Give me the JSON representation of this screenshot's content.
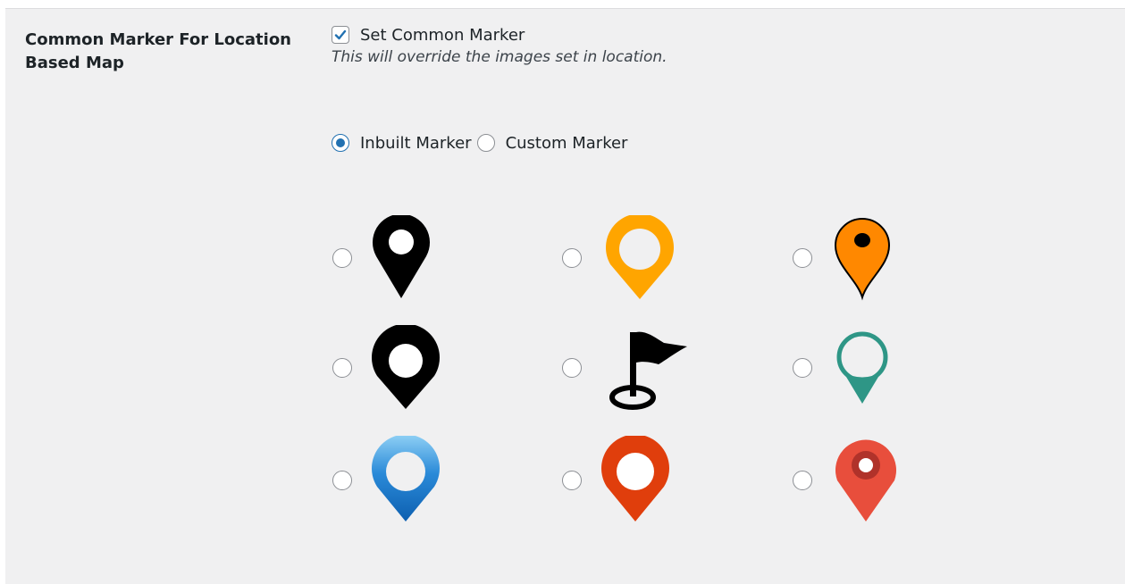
{
  "setting": {
    "label": "Common Marker For Location Based Map",
    "checkbox_label": "Set Common Marker",
    "checkbox_checked": true,
    "description": "This will override the images set in location."
  },
  "marker_type": {
    "options": [
      {
        "label": "Inbuilt Marker",
        "selected": true
      },
      {
        "label": "Custom Marker",
        "selected": false
      }
    ]
  },
  "markers": [
    {
      "icon": "black-pin-icon",
      "color": "#000000"
    },
    {
      "icon": "yellow-pin-icon",
      "color": "#ffa500"
    },
    {
      "icon": "orange-pin-icon",
      "color": "#ff8800"
    },
    {
      "icon": "black-round-pin-icon",
      "color": "#000000"
    },
    {
      "icon": "flag-icon",
      "color": "#000000"
    },
    {
      "icon": "teal-pin-icon",
      "color": "#2e9686"
    },
    {
      "icon": "blue-pin-icon",
      "color": "#1a7fd4"
    },
    {
      "icon": "red-orange-pin-icon",
      "color": "#e03e0c"
    },
    {
      "icon": "red-pin-icon",
      "color": "#e84e3c"
    }
  ],
  "colors": {
    "accent": "#2271b1",
    "panel_background": "#f0f0f1"
  }
}
